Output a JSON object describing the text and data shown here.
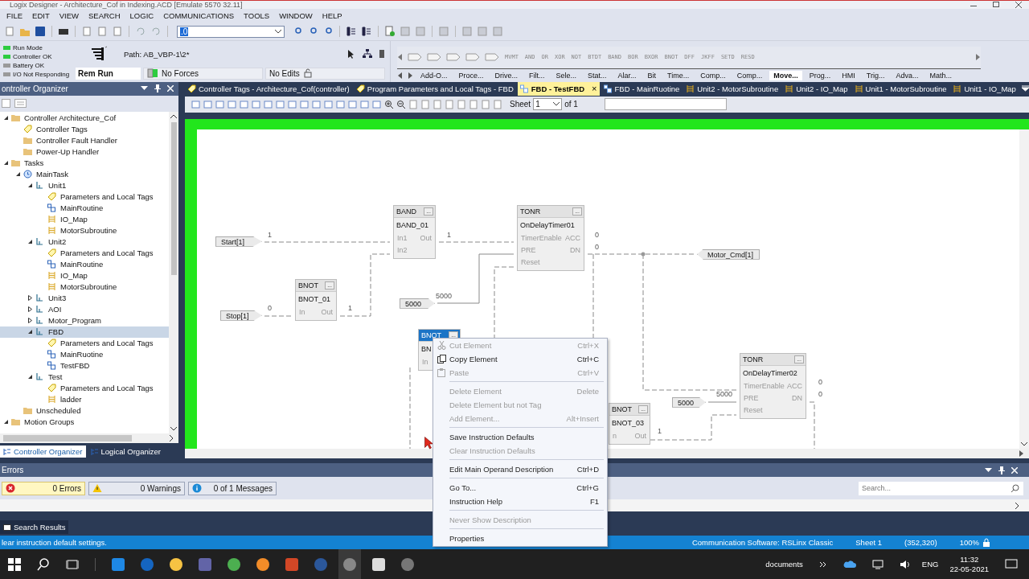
{
  "window": {
    "title": "Logix Designer - Architecture_Cof in Indexing.ACD [Emulate 5570 32.11]"
  },
  "menu": [
    "FILE",
    "EDIT",
    "VIEW",
    "SEARCH",
    "LOGIC",
    "COMMUNICATIONS",
    "TOOLS",
    "WINDOW",
    "HELP"
  ],
  "toolbar": {
    "combo_value": ".0"
  },
  "controller_status": {
    "lights": [
      {
        "label": "Run Mode",
        "color": "#2ecc40"
      },
      {
        "label": "Controller OK",
        "color": "#2ecc40"
      },
      {
        "label": "Battery OK",
        "color": "#9a9a9a"
      },
      {
        "label": "I/O Not Responding",
        "color": "#9a9a9a"
      }
    ],
    "path": "Path: AB_VBP-1\\2*",
    "mode": "Rem Run",
    "forces": "No Forces",
    "edits": "No Edits"
  },
  "instruction_palette": {
    "elements": [
      "MVMT",
      "AND",
      "OR",
      "XOR",
      "NOT",
      "BTDT",
      "BAND",
      "BOR",
      "BXOR",
      "BNOT",
      "DFF",
      "JKFF",
      "SETD",
      "RESD"
    ],
    "tabs": [
      {
        "label": "Add-O...",
        "selected": false
      },
      {
        "label": "Proce...",
        "selected": false
      },
      {
        "label": "Drive...",
        "selected": false
      },
      {
        "label": "Filt...",
        "selected": false
      },
      {
        "label": "Sele...",
        "selected": false
      },
      {
        "label": "Stat...",
        "selected": false
      },
      {
        "label": "Alar...",
        "selected": false
      },
      {
        "label": "Bit",
        "selected": false
      },
      {
        "label": "Time...",
        "selected": false
      },
      {
        "label": "Comp...",
        "selected": false
      },
      {
        "label": "Comp...",
        "selected": false
      },
      {
        "label": "Move...",
        "selected": true
      },
      {
        "label": "Prog...",
        "selected": false
      },
      {
        "label": "HMI",
        "selected": false
      },
      {
        "label": "Trig...",
        "selected": false
      },
      {
        "label": "Adva...",
        "selected": false
      },
      {
        "label": "Math...",
        "selected": false
      }
    ]
  },
  "organizer": {
    "title": "ontroller Organizer",
    "tree": [
      {
        "label": "Controller Architecture_Cof",
        "kind": "folder",
        "expanded": true,
        "selected": false,
        "children": [
          {
            "label": "Controller Tags",
            "kind": "tag",
            "selected": false
          },
          {
            "label": "Controller Fault Handler",
            "kind": "folder",
            "selected": false
          },
          {
            "label": "Power-Up Handler",
            "kind": "folder",
            "selected": false
          }
        ]
      },
      {
        "label": "Tasks",
        "kind": "folder",
        "expanded": true,
        "selected": false,
        "children": [
          {
            "label": "MainTask",
            "kind": "task",
            "expanded": true,
            "selected": false,
            "children": [
              {
                "label": "Unit1",
                "kind": "program",
                "expanded": true,
                "selected": false,
                "children": [
                  {
                    "label": "Parameters and Local Tags",
                    "kind": "tag",
                    "selected": false
                  },
                  {
                    "label": "MainRoutine",
                    "kind": "fbd",
                    "selected": false
                  },
                  {
                    "label": "IO_Map",
                    "kind": "ladder",
                    "selected": false
                  },
                  {
                    "label": "MotorSubroutine",
                    "kind": "ladder",
                    "selected": false
                  }
                ]
              },
              {
                "label": "Unit2",
                "kind": "program",
                "expanded": true,
                "selected": false,
                "children": [
                  {
                    "label": "Parameters and Local Tags",
                    "kind": "tag",
                    "selected": false
                  },
                  {
                    "label": "MainRoutine",
                    "kind": "fbd",
                    "selected": false
                  },
                  {
                    "label": "IO_Map",
                    "kind": "ladder",
                    "selected": false
                  },
                  {
                    "label": "MotorSubroutine",
                    "kind": "ladder",
                    "selected": false
                  }
                ]
              },
              {
                "label": "Unit3",
                "kind": "program",
                "expanded": false,
                "selected": false
              },
              {
                "label": "AOI",
                "kind": "program",
                "expanded": false,
                "selected": false
              },
              {
                "label": "Motor_Program",
                "kind": "program",
                "expanded": false,
                "selected": false
              },
              {
                "label": "FBD",
                "kind": "program",
                "expanded": true,
                "selected": true,
                "children": [
                  {
                    "label": "Parameters and Local Tags",
                    "kind": "tag",
                    "selected": false
                  },
                  {
                    "label": "MainRuotine",
                    "kind": "fbd",
                    "selected": false
                  },
                  {
                    "label": "TestFBD",
                    "kind": "fbd",
                    "selected": false
                  }
                ]
              },
              {
                "label": "Test",
                "kind": "program",
                "expanded": true,
                "selected": false,
                "children": [
                  {
                    "label": "Parameters and Local Tags",
                    "kind": "tag",
                    "selected": false
                  },
                  {
                    "label": "ladder",
                    "kind": "ladder",
                    "selected": false
                  }
                ]
              }
            ]
          },
          {
            "label": "Unscheduled",
            "kind": "folder",
            "selected": false
          }
        ]
      },
      {
        "label": "Motion Groups",
        "kind": "folder",
        "expanded": true,
        "selected": false
      }
    ],
    "bottom_tabs": [
      {
        "label": "Controller Organizer",
        "selected": true
      },
      {
        "label": "Logical Organizer",
        "selected": false
      }
    ]
  },
  "editor_tabs": [
    {
      "label": "Controller Tags - Architecture_Cof(controller)",
      "kind": "tags",
      "selected": false
    },
    {
      "label": "Program Parameters and Local Tags - FBD",
      "kind": "tags",
      "selected": false
    },
    {
      "label": "FBD - TestFBD",
      "kind": "fbd",
      "selected": true,
      "close": "×"
    },
    {
      "label": "FBD - MainRuotine",
      "kind": "fbd",
      "selected": false
    },
    {
      "label": "Unit2 - MotorSubroutine",
      "kind": "ladder",
      "selected": false
    },
    {
      "label": "Unit2 - IO_Map",
      "kind": "ladder",
      "selected": false
    },
    {
      "label": "Unit1 - MotorSubroutine",
      "kind": "ladder",
      "selected": false
    },
    {
      "label": "Unit1 - IO_Map",
      "kind": "ladder",
      "selected": false
    }
  ],
  "editor_toolbar": {
    "sheet_label": "Sheet",
    "sheet_value": "1",
    "sheet_of": "of 1"
  },
  "diagram": {
    "blocks": [
      {
        "type": "BAND",
        "button": "...",
        "name": "BAND_01",
        "selected": false,
        "pins": [
          {
            "in": "In1",
            "out": "Out"
          },
          {
            "in": "In2"
          }
        ]
      },
      {
        "type": "TONR",
        "button": "...",
        "name": "OnDelayTimer01",
        "selected": false,
        "pins": [
          {
            "in": "TimerEnable",
            "out": "ACC"
          },
          {
            "in": "PRE",
            "out": "DN"
          },
          {
            "in": "Reset"
          }
        ]
      },
      {
        "type": "BNOT",
        "button": "...",
        "name": "BNOT_01",
        "selected": false,
        "pins": [
          {
            "in": "In",
            "out": "Out"
          }
        ]
      },
      {
        "type": "BNOT",
        "button": "...",
        "name": "BN",
        "selected": true,
        "pins": [
          {
            "in": "In"
          }
        ]
      },
      {
        "type": "BNOT",
        "button": "...",
        "name": "BNOT_03",
        "selected": false,
        "pins": [
          {
            "in": "n",
            "out": "Out"
          }
        ]
      },
      {
        "type": "TONR",
        "button": "...",
        "name": "OnDelayTimer02",
        "selected": false,
        "pins": [
          {
            "in": "TimerEnable",
            "out": "ACC"
          },
          {
            "in": "PRE",
            "out": "DN"
          },
          {
            "in": "Reset"
          }
        ]
      }
    ],
    "references": [
      {
        "label": "Start[1]",
        "kind": "input"
      },
      {
        "label": "Stop[1]",
        "kind": "input"
      },
      {
        "label": "5000",
        "kind": "input"
      },
      {
        "label": "Motor_Cmd[1]",
        "kind": "output"
      },
      {
        "label": "5000",
        "kind": "input"
      }
    ],
    "wire_values": [
      "1",
      "1",
      "0",
      "0",
      "0",
      "1",
      "5000",
      "1",
      "0",
      "0",
      "5000"
    ]
  },
  "context_menu": [
    {
      "kind": "cut",
      "label": "Cut Element",
      "shortcut": "Ctrl+X",
      "disabled": true
    },
    {
      "kind": "copy",
      "label": "Copy Element",
      "shortcut": "Ctrl+C",
      "disabled": false
    },
    {
      "kind": "paste",
      "label": "Paste",
      "shortcut": "Ctrl+V",
      "disabled": true
    },
    {
      "kind": "separator"
    },
    {
      "kind": "item",
      "label": "Delete Element",
      "shortcut": "Delete",
      "disabled": true
    },
    {
      "kind": "item",
      "label": "Delete Element but not Tag",
      "disabled": true
    },
    {
      "kind": "item",
      "label": "Add Element...",
      "shortcut": "Alt+Insert",
      "disabled": true
    },
    {
      "kind": "separator"
    },
    {
      "kind": "item",
      "label": "Save Instruction Defaults",
      "disabled": false
    },
    {
      "kind": "item",
      "label": "Clear Instruction Defaults",
      "disabled": true
    },
    {
      "kind": "separator"
    },
    {
      "kind": "item",
      "label": "Edit Main Operand Description",
      "shortcut": "Ctrl+D",
      "disabled": false
    },
    {
      "kind": "separator"
    },
    {
      "kind": "item",
      "label": "Go To...",
      "shortcut": "Ctrl+G",
      "disabled": false
    },
    {
      "kind": "item",
      "label": "Instruction Help",
      "shortcut": "F1",
      "disabled": false
    },
    {
      "kind": "separator"
    },
    {
      "kind": "item",
      "label": "Never Show Description",
      "disabled": true
    },
    {
      "kind": "separator"
    },
    {
      "kind": "item",
      "label": "Properties",
      "disabled": false
    }
  ],
  "errors": {
    "title": "Errors",
    "filters": [
      {
        "label": "0 Errors",
        "kind": "error",
        "selected": true
      },
      {
        "label": "0 Warnings",
        "kind": "warning",
        "selected": false
      },
      {
        "label": "0 of 1 Messages",
        "kind": "info",
        "selected": false
      }
    ],
    "search": {
      "placeholder": "Search..."
    },
    "results_tab": "Search Results"
  },
  "status_bar": {
    "message": "lear instruction default settings.",
    "comm": "Communication Software: RSLinx Classic",
    "sheet": "Sheet 1",
    "coords": "(352,320)",
    "zoom": "100%"
  },
  "taskbar": {
    "apps": [
      {
        "selected": false
      },
      {
        "selected": false
      },
      {
        "selected": false
      },
      {
        "selected": false
      },
      {
        "selected": false
      },
      {
        "selected": false
      },
      {
        "selected": false
      },
      {
        "selected": false
      },
      {
        "selected": true
      },
      {
        "selected": false
      },
      {
        "selected": false
      }
    ],
    "toolbar_label": "documents",
    "language": "ENG",
    "time": "11:32",
    "date": "22-05-2021"
  }
}
